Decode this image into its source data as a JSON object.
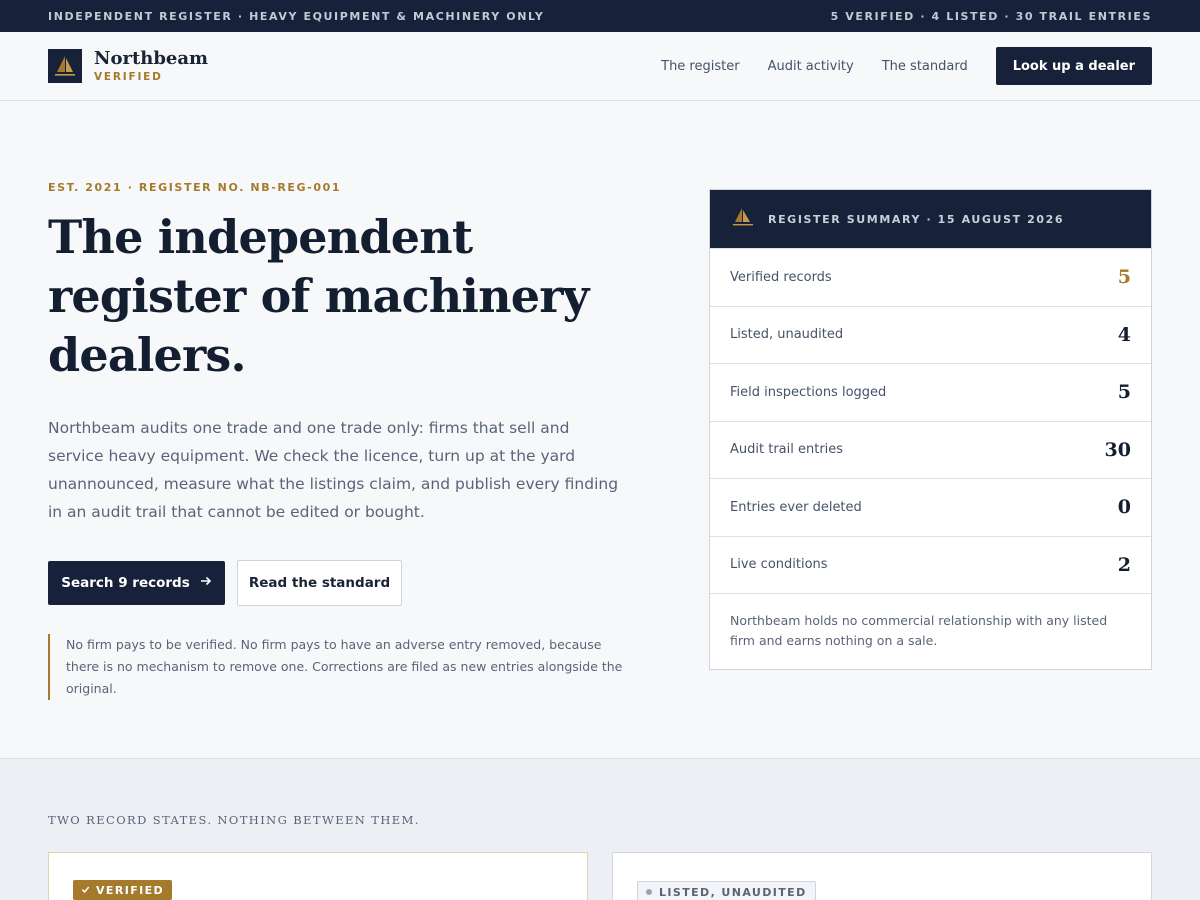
{
  "topbar": {
    "left": "INDEPENDENT REGISTER · HEAVY EQUIPMENT & MACHINERY ONLY",
    "right": "5 VERIFIED · 4 LISTED · 30 TRAIL ENTRIES"
  },
  "brand": {
    "name": "Northbeam",
    "sub": "VERIFIED",
    "icon": "sailboat-logo-icon"
  },
  "nav": {
    "items": [
      "The register",
      "Audit activity",
      "The standard"
    ],
    "cta": "Look up a dealer"
  },
  "hero": {
    "eyebrow": "EST. 2021 · REGISTER NO. NB-REG-001",
    "headline": "The independent register of machinery dealers.",
    "intro": "Northbeam audits one trade and one trade only: firms that sell and service heavy equipment. We check the licence, turn up at the yard unannounced, measure what the listings claim, and publish every finding in an audit trail that cannot be edited or bought.",
    "primary_button": "Search 9 records",
    "secondary_button": "Read the standard",
    "note": "No firm pays to be verified. No firm pays to have an adverse entry removed, because there is no mechanism to remove one. Corrections are filed as new entries alongside the original."
  },
  "summary": {
    "title": "REGISTER SUMMARY · 15 AUGUST 2026",
    "rows": [
      {
        "label": "Verified records",
        "value": "5"
      },
      {
        "label": "Listed, unaudited",
        "value": "4"
      },
      {
        "label": "Field inspections logged",
        "value": "5"
      },
      {
        "label": "Audit trail entries",
        "value": "30"
      },
      {
        "label": "Entries ever deleted",
        "value": "0"
      },
      {
        "label": "Live conditions",
        "value": "2"
      }
    ],
    "footer": "Northbeam holds no commercial relationship with any listed firm and earns nothing on a sale."
  },
  "states": {
    "eyebrow": "TWO RECORD STATES. NOTHING BETWEEN THEM.",
    "verified_badge": "VERIFIED",
    "listed_badge": "LISTED, UNAUDITED"
  },
  "colors": {
    "navy": "#17223a",
    "gold": "#a57a2c",
    "background": "#f7f8fa"
  }
}
